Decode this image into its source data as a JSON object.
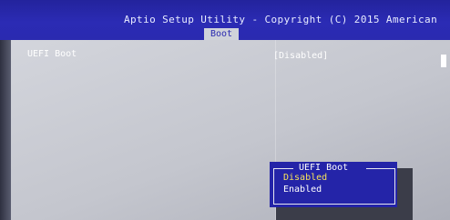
{
  "header": {
    "title": "Aptio Setup Utility - Copyright (C) 2015 American",
    "active_tab": "Boot"
  },
  "settings": [
    {
      "label": "UEFI Boot",
      "value": "[Disabled]"
    }
  ],
  "popup": {
    "title": "UEFI Boot",
    "options": [
      "Disabled",
      "Enabled"
    ],
    "selected": "Disabled"
  },
  "colors": {
    "header_bg": "#2a2ab0",
    "content_bg": "#c8cad2",
    "popup_bg": "#2424a8",
    "highlight_text": "#f6e35a"
  }
}
